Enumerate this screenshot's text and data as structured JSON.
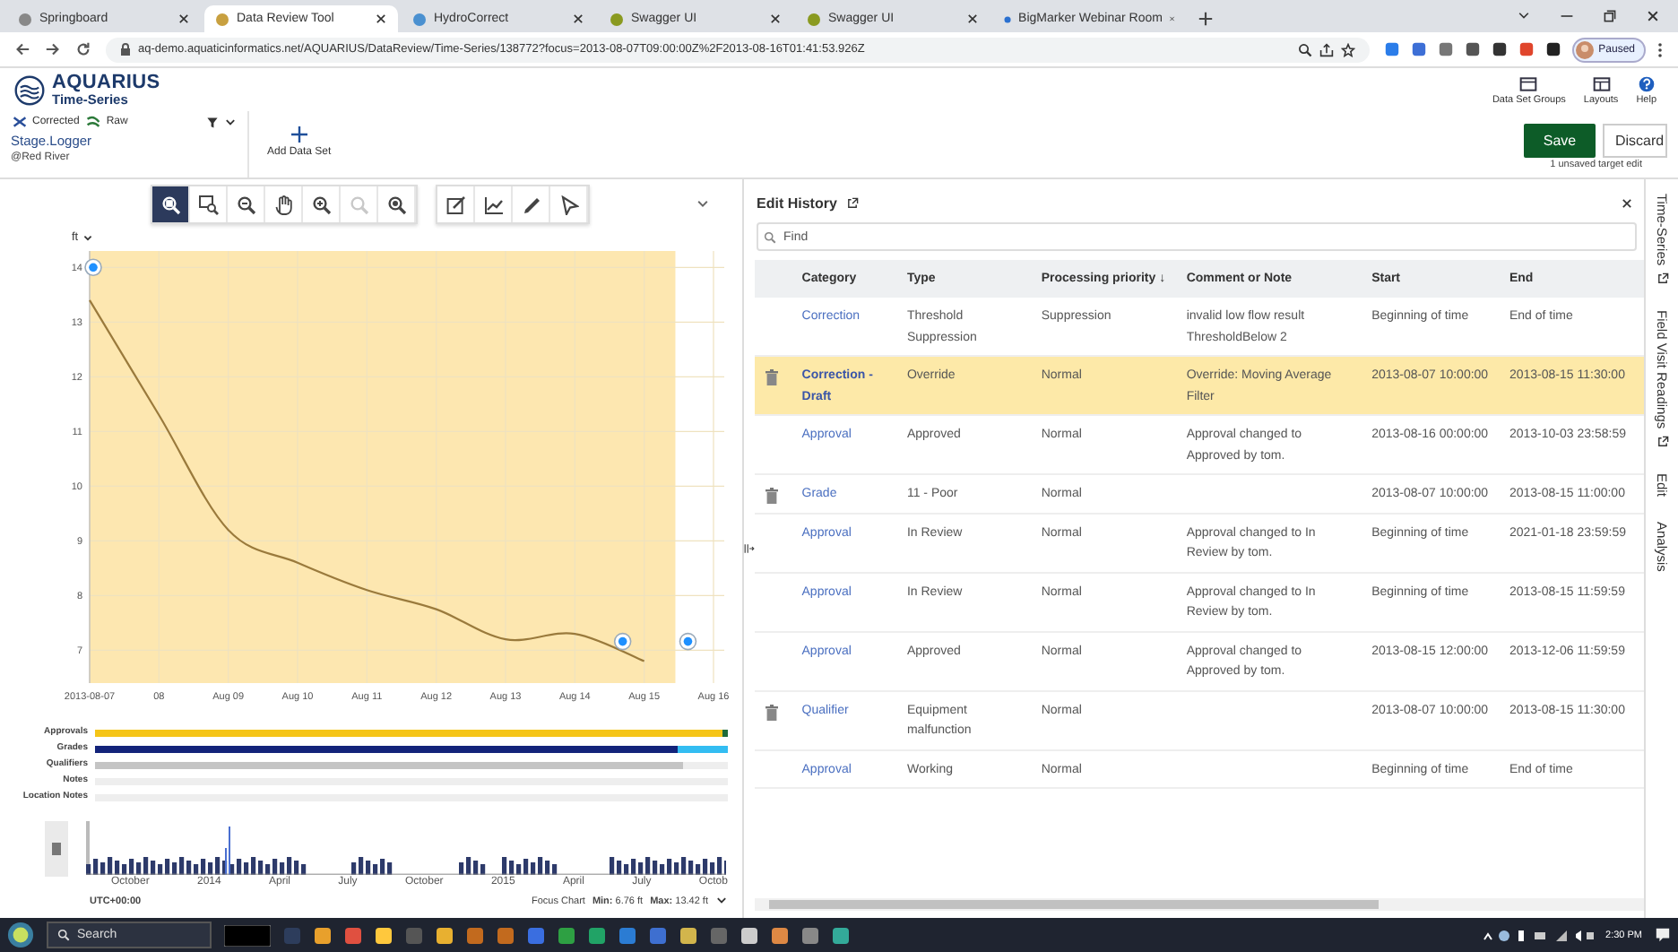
{
  "browser": {
    "tabs": [
      {
        "title": "Springboard",
        "selected": false
      },
      {
        "title": "Data Review Tool",
        "selected": true
      },
      {
        "title": "HydroCorrect",
        "selected": false
      },
      {
        "title": "Swagger UI",
        "selected": false
      },
      {
        "title": "Swagger UI",
        "selected": false
      },
      {
        "title": "BigMarker Webinar Room",
        "selected": false
      }
    ],
    "url": "aq-demo.aquaticinformatics.net/AQUARIUS/DataReview/Time-Series/138772?focus=2013-08-07T09:00:00Z%2F2013-08-16T01:41:53.926Z",
    "profile": "Paused"
  },
  "app": {
    "logo_title": "AQUARIUS",
    "logo_subtitle": "Time-Series",
    "header_actions": [
      {
        "kind": "groups",
        "label": "Data Set Groups"
      },
      {
        "kind": "layouts",
        "label": "Layouts"
      },
      {
        "kind": "help",
        "label": "Help"
      }
    ]
  },
  "dataset": {
    "legend": [
      {
        "kind": "corrected",
        "label": "Corrected"
      },
      {
        "kind": "raw",
        "label": "Raw"
      }
    ],
    "name": "Stage.Logger",
    "location": "@Red River",
    "add_label": "Add Data Set"
  },
  "edit_actions": {
    "save": "Save",
    "discard": "Discard",
    "status": "1 unsaved target edit"
  },
  "toolbar": [
    {
      "kind": "zoom-area",
      "selected": true,
      "disabled": false
    },
    {
      "kind": "zoom-box",
      "selected": false,
      "disabled": false
    },
    {
      "kind": "zoom-out",
      "selected": false,
      "disabled": false
    },
    {
      "kind": "pan",
      "selected": false,
      "disabled": false
    },
    {
      "kind": "zoom-in",
      "selected": false,
      "disabled": false
    },
    {
      "kind": "zoom-reset",
      "selected": false,
      "disabled": true
    },
    {
      "kind": "zoom-fit",
      "selected": false,
      "disabled": false
    },
    {
      "kind": "edit",
      "selected": false,
      "disabled": false
    },
    {
      "kind": "trend",
      "selected": false,
      "disabled": false
    },
    {
      "kind": "pencil",
      "selected": false,
      "disabled": false
    },
    {
      "kind": "pointer",
      "selected": false,
      "disabled": false
    }
  ],
  "chart_data": {
    "type": "line",
    "ylabel": "ft",
    "categories": [
      "2013-08-07",
      "08",
      "Aug 09",
      "Aug 10",
      "Aug 11",
      "Aug 12",
      "Aug 13",
      "Aug 14",
      "Aug 15",
      "Aug 16"
    ],
    "grid": true,
    "series": [
      {
        "color": "#9a7a3c",
        "values": [
          13.4,
          11.3,
          9.2,
          8.6,
          8.1,
          7.75,
          7.2,
          7.3,
          6.8,
          null
        ]
      }
    ],
    "ylim": [
      6.4,
      14.3
    ],
    "yticks": [
      7,
      8,
      9,
      10,
      11,
      12,
      13,
      14
    ]
  },
  "bands": [
    {
      "label": "Approvals",
      "segments": [
        {
          "color": "#f5c518",
          "level": 0.992
        },
        {
          "color": "#1f6b3a",
          "level": 0.008
        }
      ]
    },
    {
      "label": "Grades",
      "segments": [
        {
          "color": "#13237a",
          "level": 0.92
        },
        {
          "color": "#33bdf2",
          "level": 0.08
        }
      ]
    },
    {
      "label": "Qualifiers",
      "segments": [
        {
          "color": "#c4c4c4",
          "level": 0.93
        }
      ]
    },
    {
      "label": "Notes"
    },
    {
      "label": "Location Notes"
    }
  ],
  "overview": {
    "labels": [
      "October",
      "2014",
      "April",
      "July",
      "October",
      "2015",
      "April",
      "July",
      "Octob"
    ],
    "timezone": "UTC+00:00",
    "focus_label": "Focus Chart",
    "min": "**Min:** 6.76 ft",
    "max": "**Max:** 13.42 ft"
  },
  "edit_history": {
    "title": "Edit History",
    "search_placeholder": "Find",
    "columns": [
      "Category",
      "Type",
      "Processing priority ↓",
      "Comment or Note",
      "Start",
      "End"
    ],
    "rows": [
      {
        "deletable": false,
        "selected": false,
        "category": "Correction",
        "type": "Threshold Suppression",
        "priority": "Suppression",
        "comment": "invalid low flow result ThresholdBelow 2",
        "start": "Beginning of time",
        "end": "End of time"
      },
      {
        "deletable": true,
        "selected": true,
        "category": "Correction - Draft",
        "type": "Override",
        "priority": "Normal",
        "comment": "Override: Moving Average Filter",
        "start": "2013-08-07 10:00:00",
        "end": "2013-08-15 11:30:00"
      },
      {
        "deletable": false,
        "selected": false,
        "category": "Approval",
        "type": "Approved",
        "priority": "Normal",
        "comment": "Approval changed to Approved by tom.",
        "start": "2013-08-16 00:00:00",
        "end": "2013-10-03 23:58:59"
      },
      {
        "deletable": true,
        "selected": false,
        "category": "Grade",
        "type": "11 - Poor",
        "priority": "Normal",
        "start": "2013-08-07 10:00:00",
        "end": "2013-08-15 11:00:00"
      },
      {
        "deletable": false,
        "selected": false,
        "category": "Approval",
        "type": "In Review",
        "priority": "Normal",
        "comment": "Approval changed to In Review by tom.",
        "start": "Beginning of time",
        "end": "2021-01-18 23:59:59"
      },
      {
        "deletable": false,
        "selected": false,
        "category": "Approval",
        "type": "In Review",
        "priority": "Normal",
        "comment": "Approval changed to In Review by tom.",
        "start": "Beginning of time",
        "end": "2013-08-15 11:59:59"
      },
      {
        "deletable": false,
        "selected": false,
        "category": "Approval",
        "type": "Approved",
        "priority": "Normal",
        "comment": "Approval changed to Approved by tom.",
        "start": "2013-08-15 12:00:00",
        "end": "2013-12-06 11:59:59"
      },
      {
        "deletable": true,
        "selected": false,
        "category": "Qualifier",
        "type": "Equipment malfunction",
        "priority": "Normal",
        "start": "2013-08-07 10:00:00",
        "end": "2013-08-15 11:30:00"
      },
      {
        "deletable": false,
        "selected": false,
        "category": "Approval",
        "type": "Working",
        "priority": "Normal",
        "start": "Beginning of time",
        "end": "End of time"
      }
    ]
  },
  "side_tabs": [
    {
      "label": "Time-Series",
      "popout": true
    },
    {
      "label": "Field Visit Readings",
      "popout": true
    },
    {
      "label": "Edit",
      "popout": false
    },
    {
      "label": "Analysis",
      "popout": false
    }
  ],
  "taskbar": {
    "search": "Search",
    "time": "2:30 PM"
  }
}
